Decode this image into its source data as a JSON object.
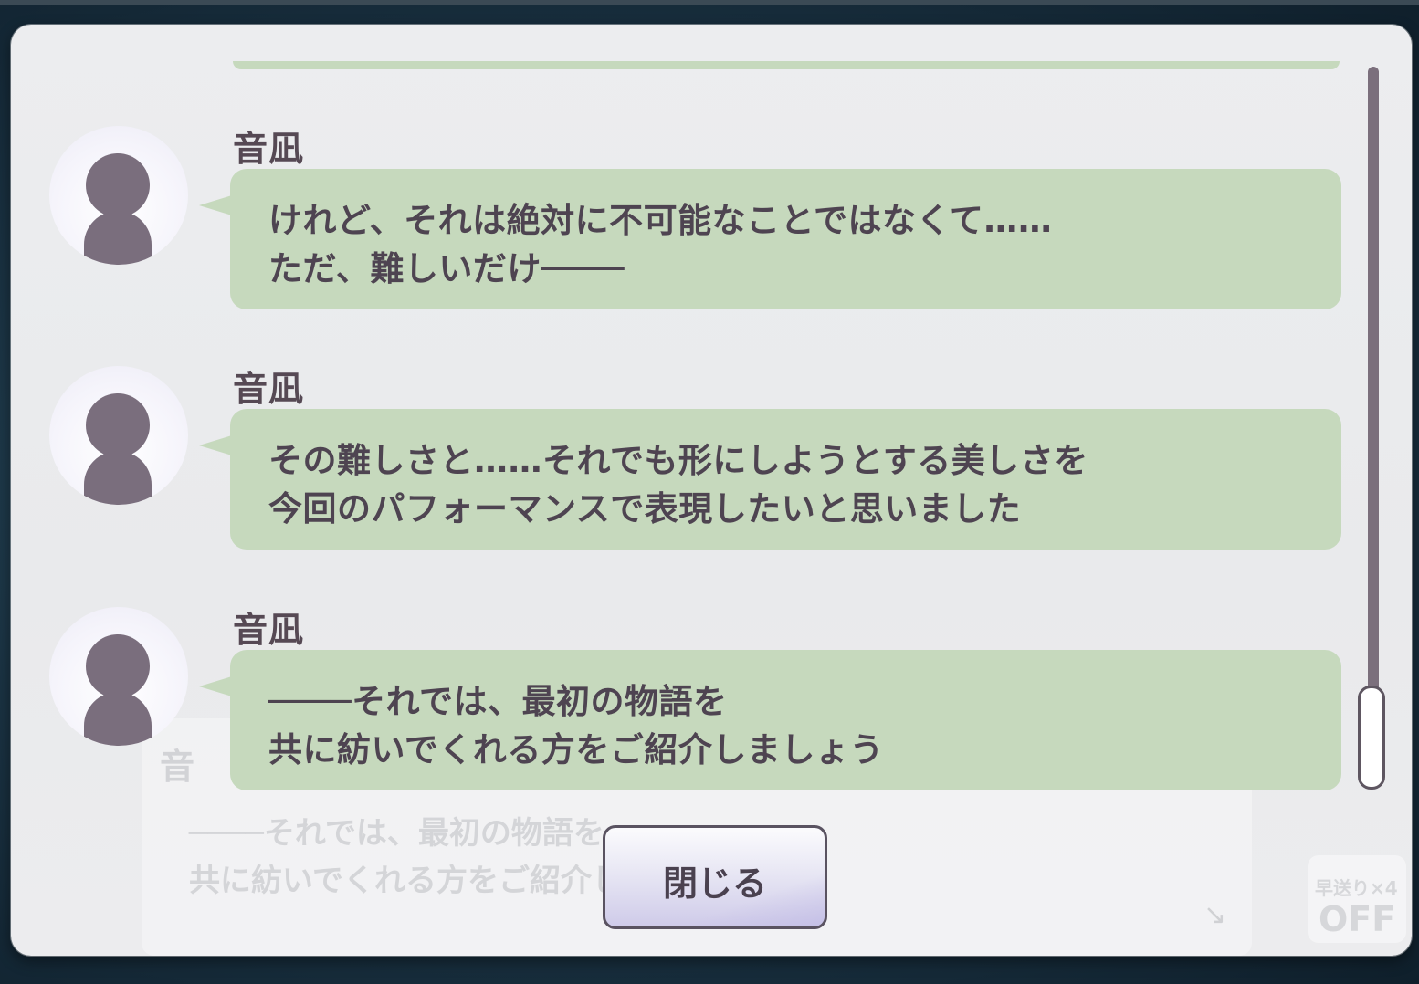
{
  "log": {
    "entries": [
      {
        "speaker": "音凪",
        "lines": [
          "けれど、それは絶対に不可能なことではなくて……",
          "ただ、難しいだけ────"
        ]
      },
      {
        "speaker": "音凪",
        "lines": [
          "その難しさと……それでも形にしようとする美しさを",
          "今回のパフォーマンスで表現したいと思いました"
        ]
      },
      {
        "speaker": "音凪",
        "lines": [
          "────それでは、最初の物語を",
          "共に紡いでくれる方をご紹介しましょう"
        ]
      }
    ],
    "scroll_position": 1.0
  },
  "close_button": {
    "label": "閉じる"
  },
  "background_dialog": {
    "speaker": "音",
    "lines": [
      "────それでは、最初の物語を",
      "共に紡いでくれる方をご紹介しましょう"
    ],
    "speed_label": "早送り×4",
    "speed_state": "OFF"
  },
  "colors": {
    "bubble": "#c6d9bd",
    "text": "#4e4451",
    "avatar_silhouette": "#7a6e7d",
    "scrollbar": "#7b6f7c"
  }
}
